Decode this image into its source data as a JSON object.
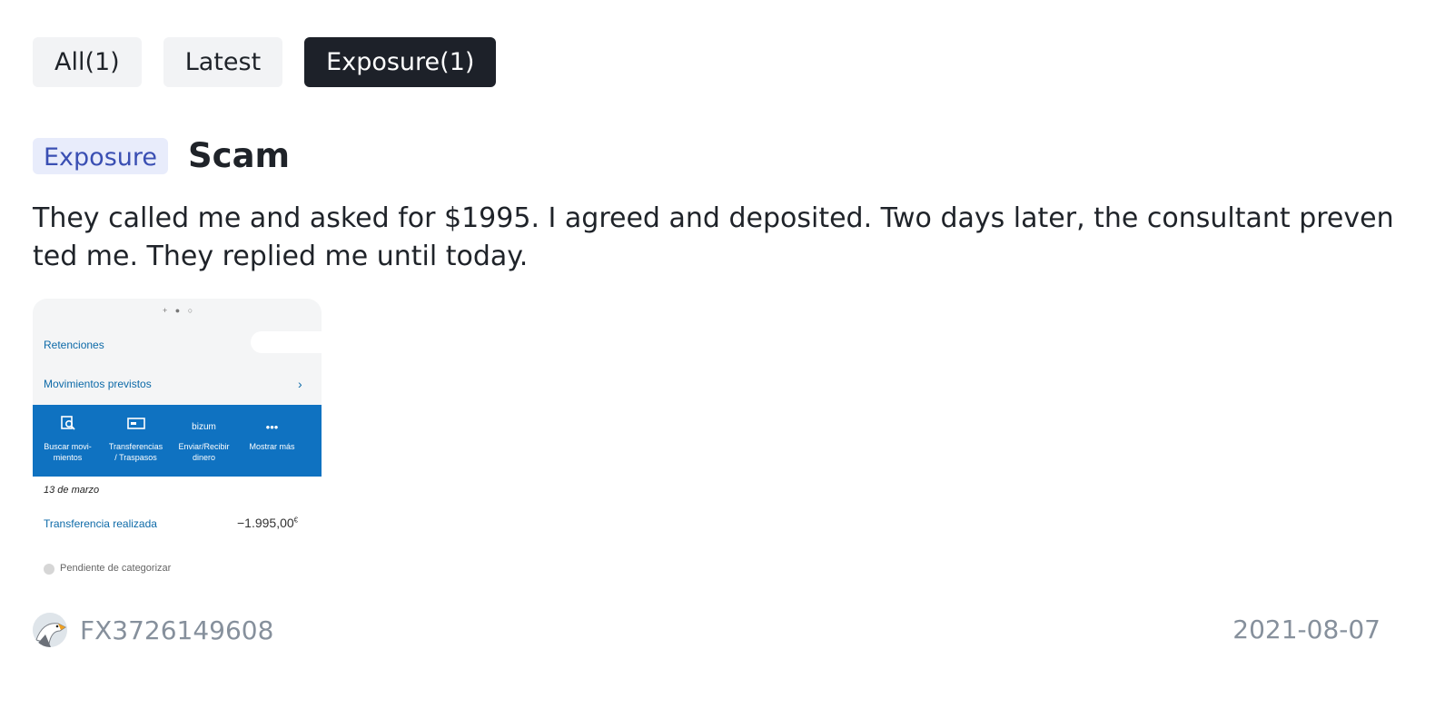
{
  "tabs": [
    {
      "label": "All(1)",
      "active": false
    },
    {
      "label": "Latest",
      "active": false
    },
    {
      "label": "Exposure(1)",
      "active": true
    }
  ],
  "post": {
    "badge": "Exposure",
    "title": "Scam",
    "description": "They called me and asked for $1995. I agreed and deposited. Two days later, the consultant prevented me. They replied me until today.",
    "username": "FX3726149608",
    "date": "2021-08-07"
  },
  "screenshot": {
    "pager": "+ ● ○",
    "retenciones": "Retenciones",
    "movimientos_previstos": "Movimientos previstos",
    "actions": [
      {
        "icon": "search-movements-icon",
        "glyph": "⌕",
        "label": "Buscar movi-\nmientos"
      },
      {
        "icon": "transfer-icon",
        "glyph": "▭",
        "label": "Transferencias\n/ Traspasos"
      },
      {
        "icon": "bizum-icon",
        "glyph": "bizum",
        "label": "Enviar/Recibir\ndinero"
      },
      {
        "icon": "more-icon",
        "glyph": "•••",
        "label": "Mostrar más"
      }
    ],
    "date_header": "13 de marzo",
    "transaction_label": "Transferencia realizada",
    "transaction_amount": "−1.995,00",
    "currency": "€",
    "pending": "Pendiente de categorizar"
  },
  "colors": {
    "active_tab_bg": "#1d2129",
    "badge_bg": "#e8ecfb",
    "badge_text": "#3a4fb3",
    "bank_blue": "#0f72c1"
  }
}
